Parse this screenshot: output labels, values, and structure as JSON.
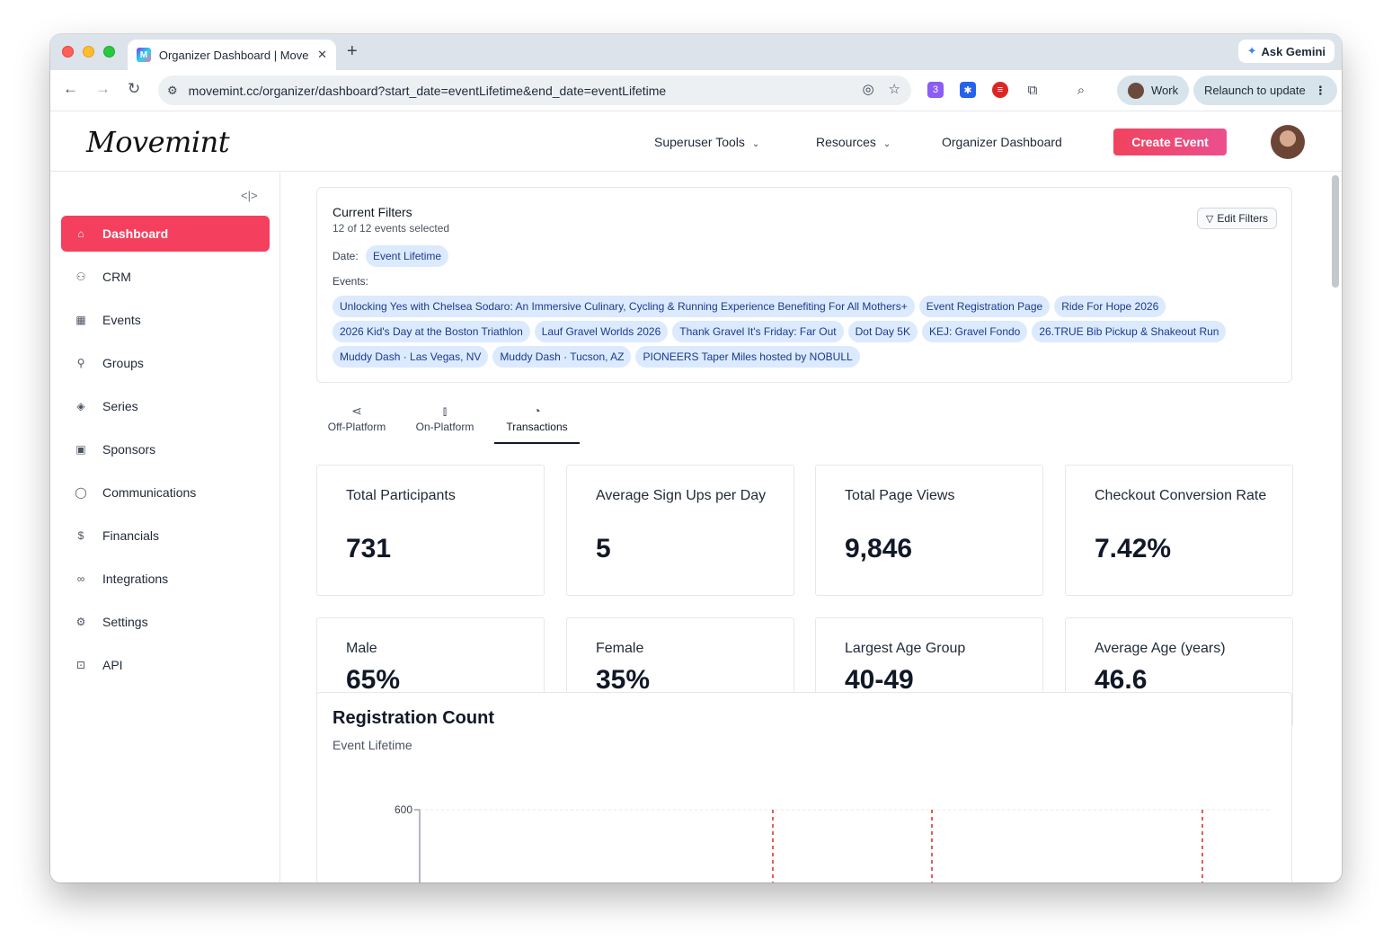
{
  "browser": {
    "tab_title": "Organizer Dashboard | Movem",
    "favicon_text": "M",
    "ask_gemini": "Ask Gemini",
    "url": "movemint.cc/organizer/dashboard?start_date=eventLifetime&end_date=eventLifetime",
    "profile_label": "Work",
    "relaunch_label": "Relaunch to update",
    "extension_badge": "3"
  },
  "header": {
    "logo": "Movemint",
    "nav": [
      "Superuser Tools",
      "Resources",
      "Organizer Dashboard"
    ],
    "create_event": "Create Event"
  },
  "sidebar": {
    "items": [
      {
        "label": "Dashboard",
        "icon": "home-icon",
        "active": true
      },
      {
        "label": "CRM",
        "icon": "users-icon"
      },
      {
        "label": "Events",
        "icon": "calendar-icon"
      },
      {
        "label": "Groups",
        "icon": "user-check-icon"
      },
      {
        "label": "Series",
        "icon": "layers-icon"
      },
      {
        "label": "Sponsors",
        "icon": "briefcase-icon"
      },
      {
        "label": "Communications",
        "icon": "message-circle-icon"
      },
      {
        "label": "Financials",
        "icon": "dollar-icon"
      },
      {
        "label": "Integrations",
        "icon": "link-icon"
      },
      {
        "label": "Settings",
        "icon": "gear-icon"
      },
      {
        "label": "API",
        "icon": "bot-icon"
      }
    ]
  },
  "filters": {
    "title": "Current Filters",
    "subtitle": "12 of 12 events selected",
    "edit_label": "Edit Filters",
    "date_label": "Date:",
    "date_value": "Event Lifetime",
    "events_label": "Events:",
    "events": [
      "Unlocking Yes with Chelsea Sodaro: An Immersive Culinary, Cycling & Running Experience Benefiting For All Mothers+",
      "Event Registration Page",
      "Ride For Hope 2026",
      "2026 Kid's Day at the Boston Triathlon",
      "Lauf Gravel Worlds 2026",
      "Thank Gravel It's Friday: Far Out",
      "Dot Day 5K",
      "KEJ: Gravel Fondo",
      "26.TRUE Bib Pickup & Shakeout Run",
      "Muddy Dash · Las Vegas, NV",
      "Muddy Dash · Tucson, AZ",
      "PIONEERS Taper Miles hosted by NOBULL"
    ]
  },
  "platform_tabs": [
    {
      "label": "Off-Platform",
      "icon": "share-icon"
    },
    {
      "label": "On-Platform",
      "icon": "bar-chart-icon"
    },
    {
      "label": "Transactions",
      "icon": "pie-chart-icon",
      "active": true
    }
  ],
  "stats_row1": [
    {
      "label": "Total Participants",
      "value": "731"
    },
    {
      "label": "Average Sign Ups per Day",
      "value": "5"
    },
    {
      "label": "Total Page Views",
      "value": "9,846"
    },
    {
      "label": "Checkout Conversion Rate",
      "value": "7.42%"
    }
  ],
  "stats_row2": [
    {
      "label": "Male",
      "value": "65%"
    },
    {
      "label": "Female",
      "value": "35%"
    },
    {
      "label": "Largest Age Group",
      "value": "40-49"
    },
    {
      "label": "Average Age (years)",
      "value": "46.6"
    }
  ],
  "registration": {
    "title": "Registration Count",
    "subtitle": "Event Lifetime",
    "y_tick_top": "600"
  },
  "colors": {
    "primary": "#f43f5e",
    "chip_bg": "#dbeafe",
    "chip_text": "#1e3a8a",
    "marker": "#dc2626"
  }
}
